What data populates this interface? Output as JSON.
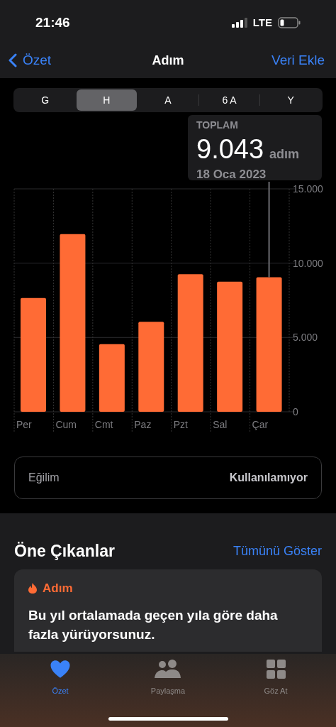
{
  "status_bar": {
    "time": "21:46",
    "network": "LTE"
  },
  "nav": {
    "back": "Özet",
    "title": "Adım",
    "action": "Veri Ekle"
  },
  "segments": [
    {
      "label": "G",
      "selected": false
    },
    {
      "label": "H",
      "selected": true
    },
    {
      "label": "A",
      "selected": false
    },
    {
      "label": "6 A",
      "selected": false
    },
    {
      "label": "Y",
      "selected": false
    }
  ],
  "tooltip": {
    "label": "TOPLAM",
    "value": "9.043",
    "unit": "adım",
    "date": "18 Oca 2023"
  },
  "chart_data": {
    "type": "bar",
    "categories": [
      "Per",
      "Cum",
      "Cmt",
      "Paz",
      "Pzt",
      "Sal",
      "Çar"
    ],
    "series": [
      {
        "color": "#ff6b35",
        "values": [
          7650,
          11950,
          4550,
          6050,
          9250,
          8750,
          9050
        ]
      }
    ],
    "ylim": [
      0,
      15000
    ],
    "yticks": [
      {
        "value": 0,
        "label": "0"
      },
      {
        "value": 5000,
        "label": "5.000"
      },
      {
        "value": 10000,
        "label": "10.000"
      },
      {
        "value": 15000,
        "label": "15.000"
      }
    ]
  },
  "trend": {
    "label": "Eğilim",
    "value": "Kullanılamıyor"
  },
  "highlights": {
    "title": "Öne Çıkanlar",
    "action": "Tümünü Göster",
    "cards": [
      {
        "category": "Adım",
        "text": "Bu yıl ortalamada geçen yıla göre daha fazla yürüyorsunuz."
      }
    ]
  },
  "tab_bar": [
    {
      "kind": "heart",
      "label": "Özet",
      "selected": true
    },
    {
      "kind": "people",
      "label": "Paylaşma",
      "selected": false
    },
    {
      "kind": "grid",
      "label": "Göz At",
      "selected": false
    }
  ]
}
